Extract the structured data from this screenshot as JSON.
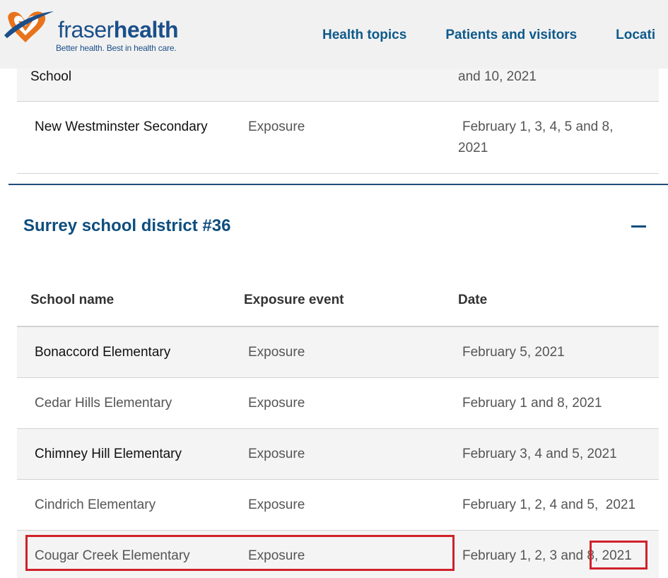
{
  "header": {
    "logo": {
      "word_a": "fraser",
      "word_b": "health",
      "tagline": "Better health. Best in health care."
    },
    "nav": [
      "Health topics",
      "Patients and visitors",
      "Locati"
    ]
  },
  "previous_table": {
    "partial_row": {
      "name": "School",
      "date": "and 10, 2021"
    },
    "rows": [
      {
        "name": "New Westminster Secondary",
        "event": "Exposure",
        "date_line1": "February 1, 3, 4, 5 and 8,",
        "date_line2": "2021"
      }
    ]
  },
  "district": {
    "title": "Surrey school district #36",
    "collapse_icon": "minus-icon"
  },
  "table": {
    "headers": [
      "School name",
      "Exposure event",
      "Date"
    ],
    "rows": [
      {
        "name": "Bonaccord Elementary",
        "event": "Exposure",
        "date": "February 5, 2021"
      },
      {
        "name": "Cedar Hills Elementary",
        "event": "Exposure",
        "date": "February 1 and 8, 2021"
      },
      {
        "name": "Chimney Hill Elementary",
        "event": "Exposure",
        "date": "February 3, 4 and 5, 2021"
      },
      {
        "name": "Cindrich Elementary",
        "event": "Exposure",
        "date": "February 1, 2, 4 and 5,  2021"
      },
      {
        "name": "Cougar Creek Elementary",
        "event": "Exposure",
        "date": "February 1, 2, 3 and 8, 2021"
      }
    ]
  },
  "colors": {
    "brand_blue": "#1b4f8a",
    "logo_orange": "#e8731c",
    "nav_blue": "#0e5a8a",
    "highlight_red": "#d0212a"
  }
}
